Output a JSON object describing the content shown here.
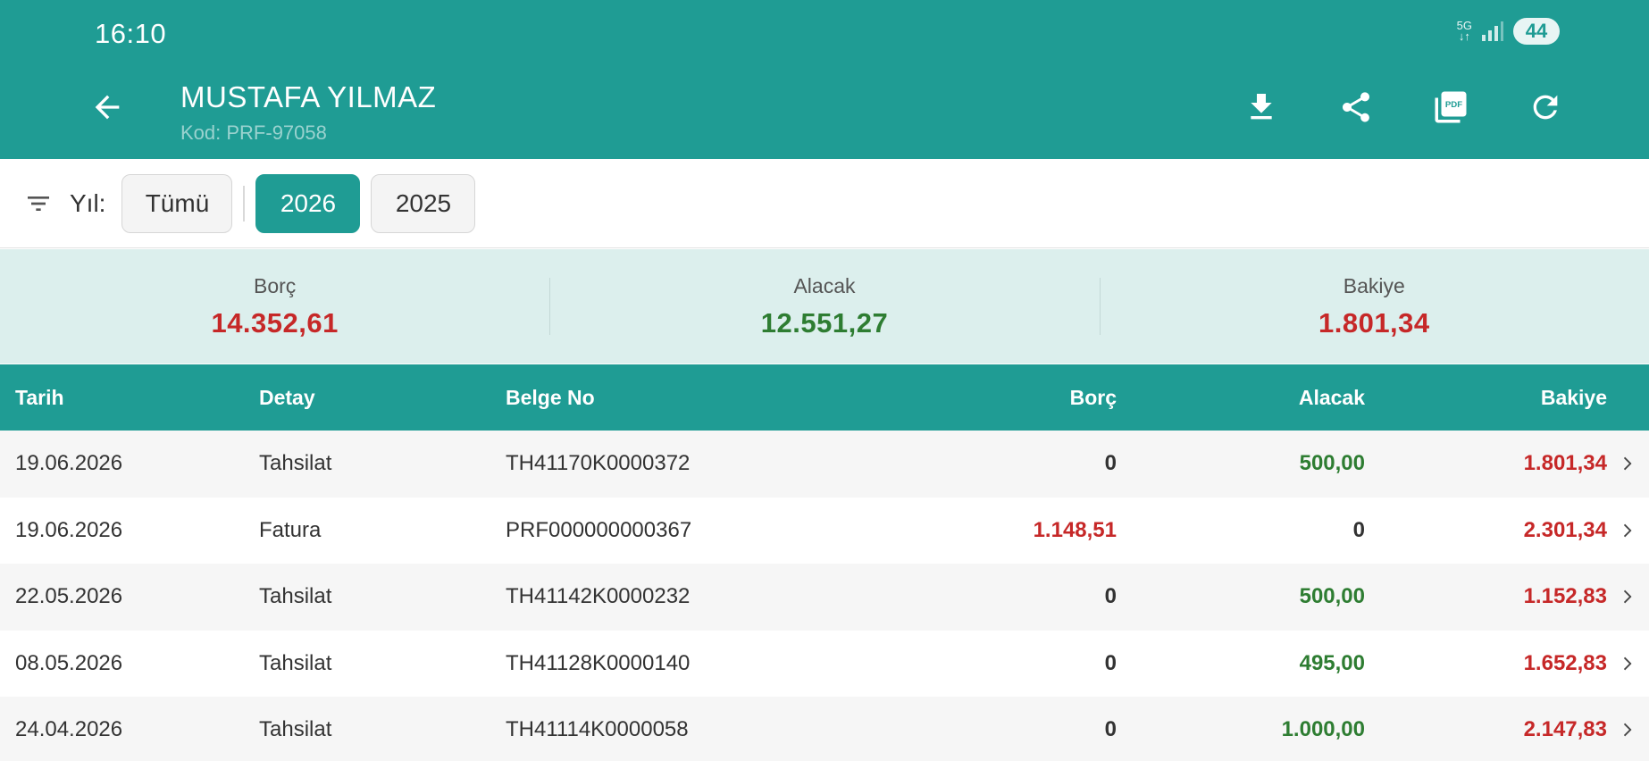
{
  "status_bar": {
    "time": "16:10",
    "network": "5G",
    "battery": "44"
  },
  "header": {
    "title": "MUSTAFA YILMAZ",
    "subtitle": "Kod: PRF-97058"
  },
  "filter": {
    "label": "Yıl:",
    "chips": [
      {
        "label": "Tümü",
        "active": false
      },
      {
        "label": "2026",
        "active": true
      },
      {
        "label": "2025",
        "active": false
      }
    ]
  },
  "summary": {
    "borc": {
      "label": "Borç",
      "value": "14.352,61"
    },
    "alacak": {
      "label": "Alacak",
      "value": "12.551,27"
    },
    "bakiye": {
      "label": "Bakiye",
      "value": "1.801,34"
    }
  },
  "table": {
    "columns": [
      "Tarih",
      "Detay",
      "Belge No",
      "Borç",
      "Alacak",
      "Bakiye"
    ],
    "rows": [
      {
        "tarih": "19.06.2026",
        "detay": "Tahsilat",
        "belge": "TH41170K0000372",
        "borc": "0",
        "alacak": "500,00",
        "bakiye": "1.801,34"
      },
      {
        "tarih": "19.06.2026",
        "detay": "Fatura",
        "belge": "PRF000000000367",
        "borc": "1.148,51",
        "alacak": "0",
        "bakiye": "2.301,34"
      },
      {
        "tarih": "22.05.2026",
        "detay": "Tahsilat",
        "belge": "TH41142K0000232",
        "borc": "0",
        "alacak": "500,00",
        "bakiye": "1.152,83"
      },
      {
        "tarih": "08.05.2026",
        "detay": "Tahsilat",
        "belge": "TH41128K0000140",
        "borc": "0",
        "alacak": "495,00",
        "bakiye": "1.652,83"
      },
      {
        "tarih": "24.04.2026",
        "detay": "Tahsilat",
        "belge": "TH41114K0000058",
        "borc": "0",
        "alacak": "1.000,00",
        "bakiye": "2.147,83"
      }
    ]
  },
  "colors": {
    "primary": "#1f9c94",
    "debt": "#c62828",
    "credit": "#2e7d32",
    "summary_bg": "#dcefed"
  },
  "icons": [
    "back-arrow-icon",
    "download-icon",
    "share-icon",
    "pdf-icon",
    "refresh-icon",
    "filter-icon",
    "chevron-right-icon"
  ]
}
